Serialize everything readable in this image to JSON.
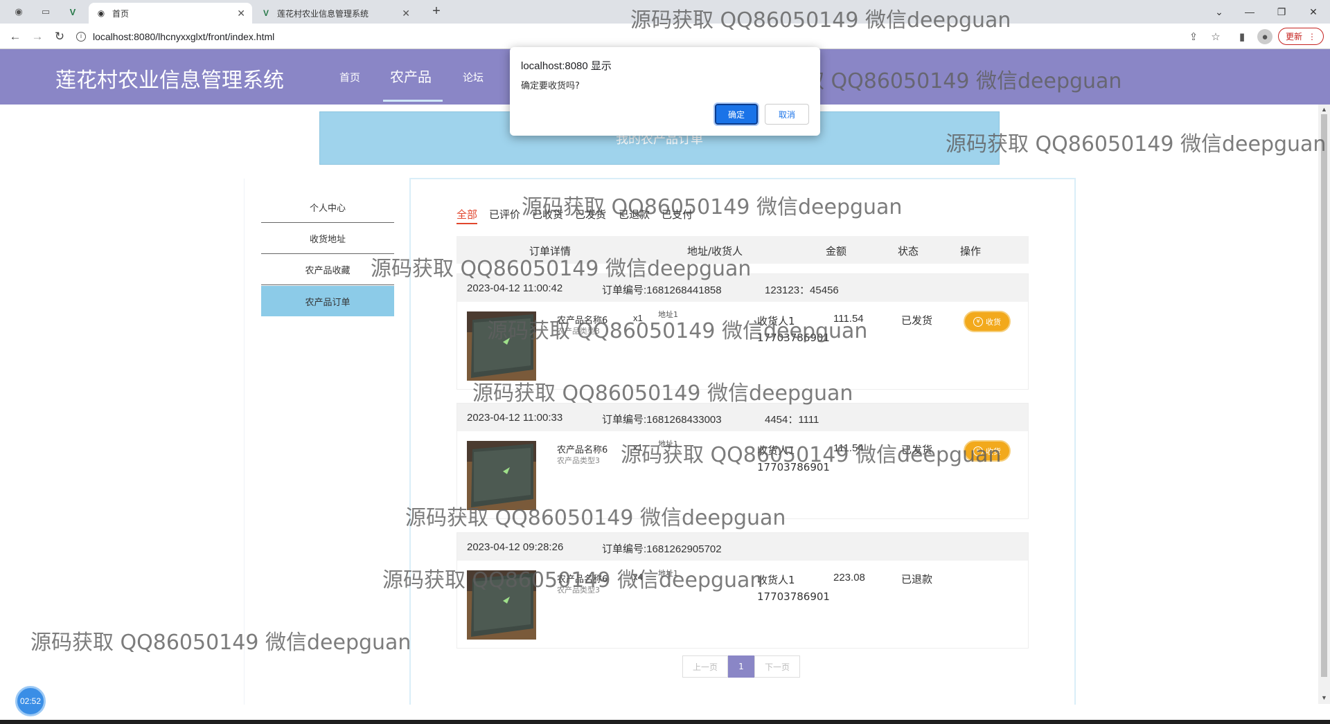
{
  "browser": {
    "tabs": [
      {
        "title": "首页",
        "active": true
      },
      {
        "title": "莲花村农业信息管理系统",
        "active": false
      }
    ],
    "url": "localhost:8080/lhcnyxxglxt/front/index.html",
    "update_label": "更新",
    "icons": [
      "back-icon",
      "forward-icon",
      "reload-icon",
      "info-icon",
      "share-icon",
      "star-icon",
      "sidebar-icon",
      "profile-icon",
      "menu-icon"
    ]
  },
  "header": {
    "site_title": "莲花村农业信息管理系统",
    "nav": [
      "首页",
      "农产品",
      "论坛"
    ],
    "active_nav": "农产品",
    "bg_color": "#8a86c6"
  },
  "banner": {
    "title": "我的农产品订单"
  },
  "sidebar": {
    "items": [
      "个人中心",
      "收货地址",
      "农产品收藏",
      "农产品订单"
    ],
    "active": "农产品订单"
  },
  "filters": {
    "tabs": [
      "全部",
      "已评价",
      "已收货",
      "已发货",
      "已退款",
      "已支付"
    ],
    "active": "全部"
  },
  "table": {
    "headers": [
      "订单详情",
      "地址/收货人",
      "金额",
      "状态",
      "操作"
    ]
  },
  "orders": [
    {
      "time": "2023-04-12 11:00:42",
      "order_no": "订单编号:1681268441858",
      "extra": "123123：45456",
      "product_name": "农产品名称6",
      "product_type": "农产品类型3",
      "qty": "x1",
      "address": "地址1",
      "receiver": "收货人1",
      "phone": "17703786901",
      "amount": "111.54",
      "status": "已发货",
      "action": "收货"
    },
    {
      "time": "2023-04-12 11:00:33",
      "order_no": "订单编号:1681268433003",
      "extra": "4454：1111",
      "product_name": "农产品名称6",
      "product_type": "农产品类型3",
      "qty": "x1",
      "address": "地址1",
      "receiver": "收货人1",
      "phone": "17703786901",
      "amount": "111.54",
      "status": "已发货",
      "action": "收货"
    },
    {
      "time": "2023-04-12 09:28:26",
      "order_no": "订单编号:1681262905702",
      "extra": "",
      "product_name": "农产品名称6",
      "product_type": "农产品类型3",
      "qty": "x4",
      "address": "地址1",
      "receiver": "收货人1",
      "phone": "17703786901",
      "amount": "223.08",
      "status": "已退款",
      "action": ""
    }
  ],
  "pagination": {
    "prev": "上一页",
    "current": "1",
    "next": "下一页"
  },
  "dialog": {
    "title": "localhost:8080 显示",
    "message": "确定要收货吗?",
    "ok": "确定",
    "cancel": "取消"
  },
  "watermark": "源码获取 QQ86050149 微信deepguan",
  "timer": "02:52"
}
